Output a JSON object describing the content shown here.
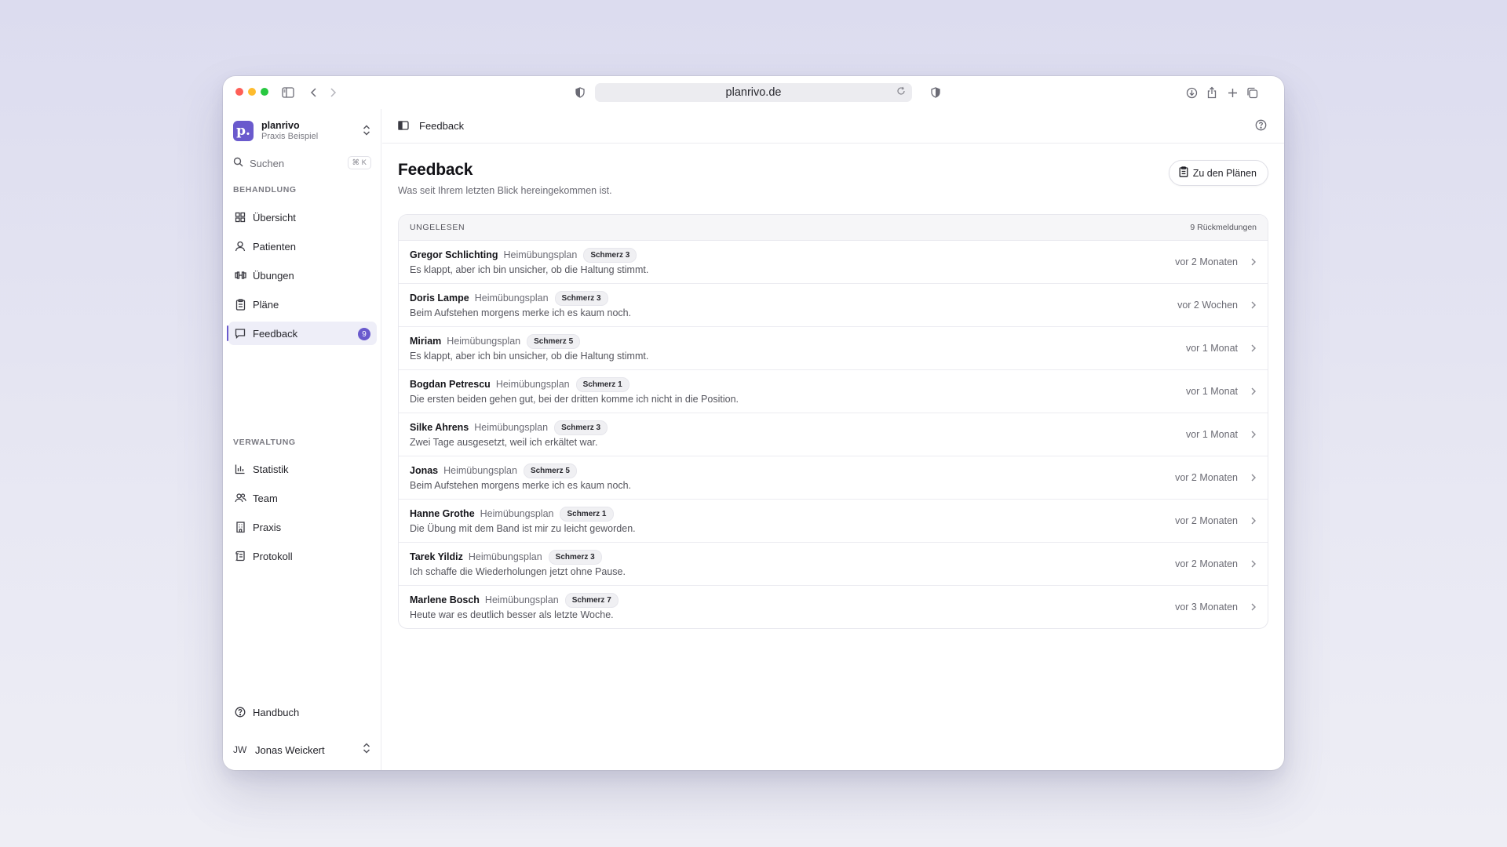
{
  "browser": {
    "url": "planrivo.de"
  },
  "colors": {
    "accent": "#6a5acd",
    "traffic_red": "#fe5f57",
    "traffic_yellow": "#febc2e",
    "traffic_green": "#28c840"
  },
  "sidebar": {
    "org_logo": "p.",
    "org_name": "planrivo",
    "org_sub": "Praxis Beispiel",
    "search_label": "Suchen",
    "search_shortcut": "⌘ K",
    "section_behandlung": "BEHANDLUNG",
    "section_verwaltung": "VERWALTUNG",
    "items": [
      {
        "label": "Übersicht",
        "icon": "grid-icon"
      },
      {
        "label": "Patienten",
        "icon": "user-icon"
      },
      {
        "label": "Übungen",
        "icon": "dumbbell-icon"
      },
      {
        "label": "Pläne",
        "icon": "clipboard-icon"
      },
      {
        "label": "Feedback",
        "icon": "message-icon",
        "badge": "9",
        "active": true
      },
      {
        "label": "Statistik",
        "icon": "bar-chart-icon"
      },
      {
        "label": "Team",
        "icon": "users-icon"
      },
      {
        "label": "Praxis",
        "icon": "building-icon"
      },
      {
        "label": "Protokoll",
        "icon": "log-icon"
      }
    ],
    "help_label": "Handbuch",
    "user_initials": "JW",
    "user_name": "Jonas Weickert"
  },
  "topbar": {
    "breadcrumb": "Feedback"
  },
  "page": {
    "title": "Feedback",
    "subtitle": "Was seit Ihrem letzten Blick hereingekommen ist.",
    "plans_button": "Zu den Plänen"
  },
  "list": {
    "header_label": "UNGELESEN",
    "header_count": "9 Rückmeldungen",
    "rows": [
      {
        "name": "Gregor Schlichting",
        "plan": "Heimübungsplan",
        "pain": "Schmerz 3",
        "message": "Es klappt, aber ich bin unsicher, ob die Haltung stimmt.",
        "time": "vor 2 Monaten"
      },
      {
        "name": "Doris Lampe",
        "plan": "Heimübungsplan",
        "pain": "Schmerz 3",
        "message": "Beim Aufstehen morgens merke ich es kaum noch.",
        "time": "vor 2 Wochen"
      },
      {
        "name": "Miriam",
        "plan": "Heimübungsplan",
        "pain": "Schmerz 5",
        "message": "Es klappt, aber ich bin unsicher, ob die Haltung stimmt.",
        "time": "vor 1 Monat"
      },
      {
        "name": "Bogdan Petrescu",
        "plan": "Heimübungsplan",
        "pain": "Schmerz 1",
        "message": "Die ersten beiden gehen gut, bei der dritten komme ich nicht in die Position.",
        "time": "vor 1 Monat"
      },
      {
        "name": "Silke Ahrens",
        "plan": "Heimübungsplan",
        "pain": "Schmerz 3",
        "message": "Zwei Tage ausgesetzt, weil ich erkältet war.",
        "time": "vor 1 Monat"
      },
      {
        "name": "Jonas",
        "plan": "Heimübungsplan",
        "pain": "Schmerz 5",
        "message": "Beim Aufstehen morgens merke ich es kaum noch.",
        "time": "vor 2 Monaten"
      },
      {
        "name": "Hanne Grothe",
        "plan": "Heimübungsplan",
        "pain": "Schmerz 1",
        "message": "Die Übung mit dem Band ist mir zu leicht geworden.",
        "time": "vor 2 Monaten"
      },
      {
        "name": "Tarek Yildiz",
        "plan": "Heimübungsplan",
        "pain": "Schmerz 3",
        "message": "Ich schaffe die Wiederholungen jetzt ohne Pause.",
        "time": "vor 2 Monaten"
      },
      {
        "name": "Marlene Bosch",
        "plan": "Heimübungsplan",
        "pain": "Schmerz 7",
        "message": "Heute war es deutlich besser als letzte Woche.",
        "time": "vor 3 Monaten"
      }
    ]
  }
}
